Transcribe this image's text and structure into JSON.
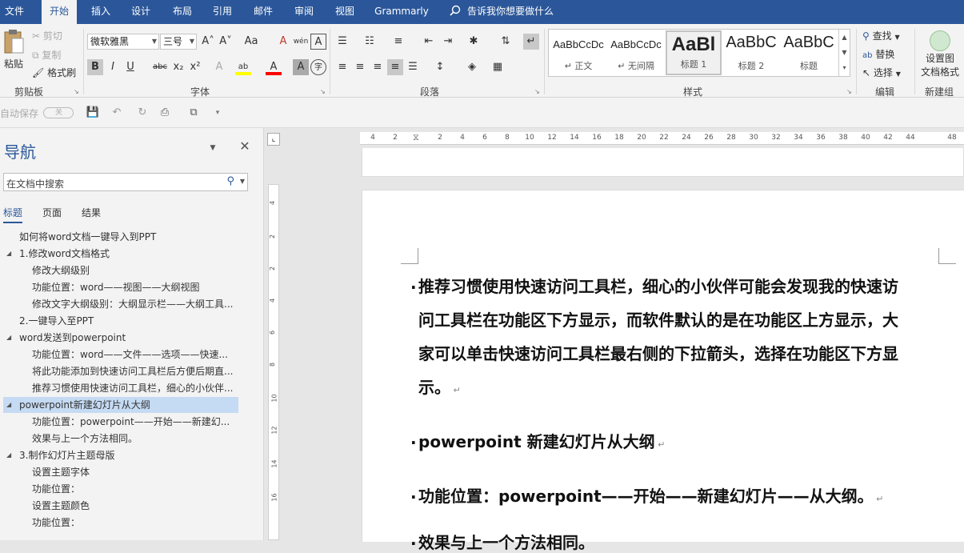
{
  "tabs": [
    "文件",
    "开始",
    "插入",
    "设计",
    "布局",
    "引用",
    "邮件",
    "审阅",
    "视图",
    "Grammarly"
  ],
  "tell_me": "告诉我你想要做什么",
  "clipboard": {
    "paste": "粘贴",
    "cut": "剪切",
    "copy": "复制",
    "format_painter": "格式刷",
    "label": "剪贴板"
  },
  "font": {
    "name": "微软雅黑",
    "size": "三号",
    "label": "字体",
    "bold": "B",
    "italic": "I",
    "underline": "U",
    "strike": "abc",
    "sub": "x₂",
    "sup": "x²",
    "grow": "A˄",
    "shrink": "A˅",
    "case": "Aa",
    "clear": "A",
    "phonetic": "wén",
    "border": "A",
    "effects": "A",
    "highlight": "ab",
    "color": "A",
    "shade": "A",
    "circle": "字"
  },
  "paragraph": {
    "label": "段落"
  },
  "styles": {
    "label": "样式",
    "items": [
      {
        "preview": "AaBbCcDc",
        "name": "↵ 正文"
      },
      {
        "preview": "AaBbCcDc",
        "name": "↵ 无间隔"
      },
      {
        "preview": "AaBl",
        "name": "标题 1"
      },
      {
        "preview": "AaBbC",
        "name": "标题 2"
      },
      {
        "preview": "AaBbC",
        "name": "标题"
      }
    ]
  },
  "editing": {
    "label": "编辑",
    "find": "查找",
    "replace": "替换",
    "select": "选择"
  },
  "new_group": {
    "label": "新建组",
    "btn_line1": "设置图",
    "btn_line2": "文档格式"
  },
  "qat": {
    "autosave": "自动保存",
    "toggle": "关"
  },
  "nav": {
    "title": "导航",
    "search_placeholder": "在文档中搜索",
    "tabs": [
      "标题",
      "页面",
      "结果"
    ],
    "headings": [
      {
        "text": "如何将word文档一键导入到PPT",
        "level": 0,
        "tri": false,
        "selected": false
      },
      {
        "text": "1.修改word文档格式",
        "level": 0,
        "tri": true,
        "selected": false
      },
      {
        "text": "修改大纲级别",
        "level": 1,
        "tri": false,
        "selected": false
      },
      {
        "text": "功能位置：word——视图——大纲视图",
        "level": 1,
        "tri": false,
        "selected": false
      },
      {
        "text": "修改文字大纲级别：大纲显示栏——大纲工具...",
        "level": 1,
        "tri": false,
        "selected": false
      },
      {
        "text": "2.一键导入至PPT",
        "level": 0,
        "tri": false,
        "selected": false
      },
      {
        "text": "word发送到powerpoint",
        "level": 0,
        "tri": true,
        "selected": false
      },
      {
        "text": "功能位置：word——文件——选项——快速...",
        "level": 1,
        "tri": false,
        "selected": false
      },
      {
        "text": "将此功能添加到快速访问工具栏后方便后期直...",
        "level": 1,
        "tri": false,
        "selected": false
      },
      {
        "text": "推荐习惯使用快速访问工具栏，细心的小伙伴...",
        "level": 1,
        "tri": false,
        "selected": false
      },
      {
        "text": "powerpoint新建幻灯片从大纲",
        "level": 0,
        "tri": true,
        "selected": true
      },
      {
        "text": "功能位置：powerpoint——开始——新建幻...",
        "level": 1,
        "tri": false,
        "selected": false
      },
      {
        "text": "效果与上一个方法相同。",
        "level": 1,
        "tri": false,
        "selected": false
      },
      {
        "text": "3.制作幻灯片主题母版",
        "level": 0,
        "tri": true,
        "selected": false
      },
      {
        "text": "设置主题字体",
        "level": 1,
        "tri": false,
        "selected": false
      },
      {
        "text": "功能位置：",
        "level": 1,
        "tri": false,
        "selected": false
      },
      {
        "text": "设置主题颜色",
        "level": 1,
        "tri": false,
        "selected": false
      },
      {
        "text": "功能位置：",
        "level": 1,
        "tri": false,
        "selected": false
      }
    ]
  },
  "ruler": {
    "h_ticks": [
      "4",
      "2",
      "2",
      "4",
      "6",
      "8",
      "10",
      "12",
      "14",
      "16",
      "18",
      "20",
      "22",
      "24",
      "26",
      "28",
      "30",
      "32",
      "34",
      "36",
      "38",
      "40",
      "42",
      "44",
      "48"
    ],
    "v_ticks": [
      "4",
      "2",
      "2",
      "4",
      "6",
      "8",
      "10",
      "12",
      "14",
      "16"
    ]
  },
  "document": {
    "paragraphs": [
      [
        "推荐习惯使用快速访问工具栏，细心的小伙伴可能会发现我的快速访",
        "问工具栏在功能区下方显示，而软件默认的是在功能区上方显示，大",
        "家可以单击快速访问工具栏最右侧的下拉箭头，选择在功能区下方显",
        "示。"
      ],
      "powerpoint 新建幻灯片从大纲",
      "功能位置：powerpoint——开始——新建幻灯片——从大纲。",
      "效果与上一个方法相同。"
    ]
  },
  "colors": {
    "accent": "#2b579a",
    "ribbon_bg": "#f3f3f3",
    "nav_selected": "#c5daf3",
    "highlight": "#ffff00",
    "font_color": "#ff0000"
  }
}
